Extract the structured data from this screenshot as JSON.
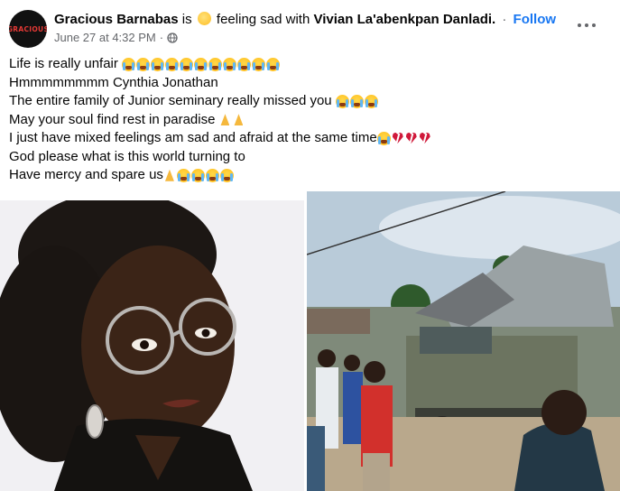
{
  "post": {
    "avatar_text": "GRACIOUS",
    "author": "Gracious Barnabas",
    "is_text": "is",
    "feeling_text": "feeling sad with",
    "tagged": "Vivian La'abenkpan Danladi.",
    "separator": "·",
    "follow_label": "Follow",
    "timestamp": "June 27 at 4:32 PM",
    "meta_separator": "·",
    "privacy_icon": "globe-icon",
    "more_icon": "more-options-icon",
    "lines": [
      "Life is really unfair",
      "Hmmmmmmmm Cynthia Jonathan",
      "The entire family of Junior seminary really missed you",
      "May your soul find rest in paradise",
      "I just have mixed feelings am sad and afraid at the same time",
      "God please what is this world turning to",
      "Have mercy and spare us"
    ]
  },
  "photos": [
    {
      "subject": "woman-portrait"
    },
    {
      "subject": "truck-crash-scene"
    }
  ],
  "colors": {
    "link": "#1877f2",
    "muted": "#65676b",
    "text": "#050505"
  }
}
